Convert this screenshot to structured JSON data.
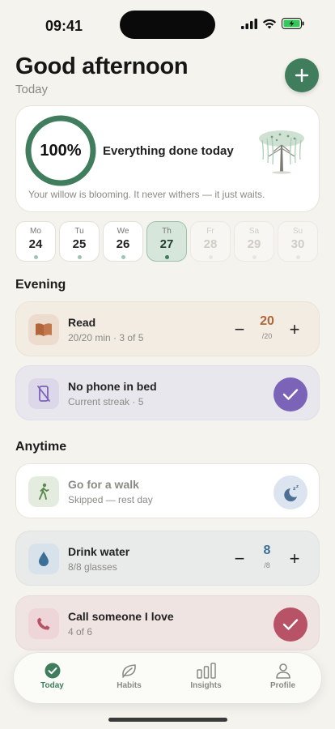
{
  "status_bar": {
    "time": "09:41"
  },
  "header": {
    "greeting": "Good afternoon",
    "subtitle": "Today",
    "add_button_icon": "plus-icon"
  },
  "summary": {
    "percent_label": "100%",
    "progress_fraction": 1.0,
    "title": "Everything done today",
    "message": "Your willow is blooming. It never withers — it just waits."
  },
  "week": [
    {
      "dow": "Mo",
      "date": "24",
      "state": "done"
    },
    {
      "dow": "Tu",
      "date": "25",
      "state": "done"
    },
    {
      "dow": "We",
      "date": "26",
      "state": "done"
    },
    {
      "dow": "Th",
      "date": "27",
      "state": "today"
    },
    {
      "dow": "Fr",
      "date": "28",
      "state": "future"
    },
    {
      "dow": "Sa",
      "date": "29",
      "state": "future"
    },
    {
      "dow": "Su",
      "date": "30",
      "state": "future"
    }
  ],
  "sections": {
    "evening": "Evening",
    "anytime": "Anytime"
  },
  "habits": {
    "read": {
      "title": "Read",
      "subtitle": "20/20 min · 3 of 5",
      "value": "20",
      "of": "/20",
      "minus": "−",
      "plus": "+",
      "color": "#b2653a"
    },
    "no_phone": {
      "title": "No phone in bed",
      "subtitle": "Current streak · 5",
      "color": "#7b63b8"
    },
    "walk": {
      "title": "Go for a walk",
      "subtitle": "Skipped — rest day",
      "color": "#5a8a4f"
    },
    "water": {
      "title": "Drink water",
      "subtitle": "8/8 glasses",
      "value": "8",
      "of": "/8",
      "minus": "−",
      "plus": "+",
      "color": "#3b6f96"
    },
    "call": {
      "title": "Call someone I love",
      "subtitle": "4 of 6",
      "color": "#b85266"
    }
  },
  "tabs": [
    {
      "label": "Today",
      "icon": "check-circle-icon",
      "active": true
    },
    {
      "label": "Habits",
      "icon": "leaf-icon",
      "active": false
    },
    {
      "label": "Insights",
      "icon": "bar-chart-icon",
      "active": false
    },
    {
      "label": "Profile",
      "icon": "person-icon",
      "active": false
    }
  ]
}
